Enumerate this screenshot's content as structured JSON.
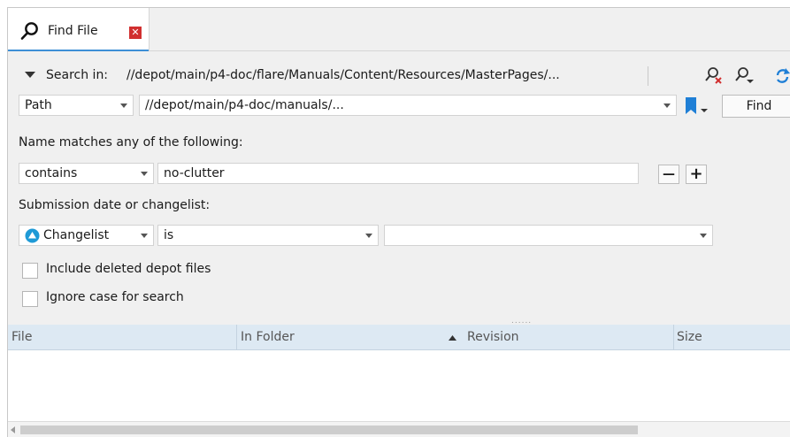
{
  "tab": {
    "label": "Find File",
    "close_glyph": "✕"
  },
  "search_in": {
    "label": "Search in:",
    "path": "//depot/main/p4-doc/flare/Manuals/Content/Resources/MasterPages/..."
  },
  "path_row": {
    "type_value": "Path",
    "path_value": "//depot/main/p4-doc/manuals/...",
    "find_label": "Find"
  },
  "name_section": {
    "label": "Name matches any of the following:",
    "operator": "contains",
    "value": "no-clutter",
    "remove_glyph": "—",
    "add_glyph": "+"
  },
  "date_section": {
    "label": "Submission date or changelist:",
    "mode": "Changelist",
    "operator": "is",
    "value": ""
  },
  "options": {
    "include_deleted": {
      "label": "Include deleted depot files",
      "checked": false
    },
    "ignore_case": {
      "label": "Ignore case for search",
      "checked": false
    }
  },
  "results": {
    "columns": [
      "File",
      "In Folder",
      "Revision",
      "Size"
    ],
    "sorted_column": "In Folder",
    "rows": []
  },
  "colors": {
    "accent": "#3d8fd6",
    "close": "#d12f2f",
    "bookmark": "#1f7fd6",
    "header_bg": "#dde9f3"
  }
}
